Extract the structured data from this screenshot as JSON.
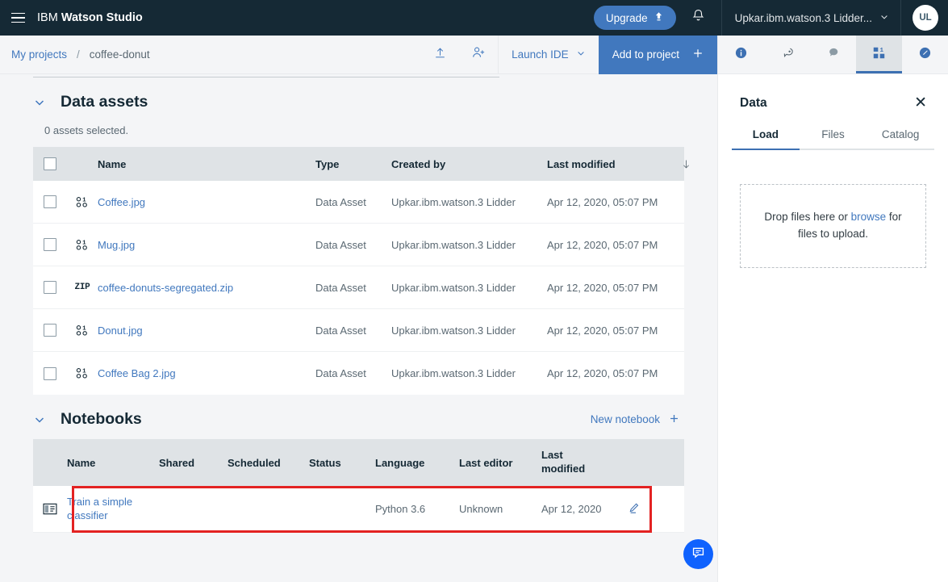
{
  "topbar": {
    "menu_icon": "hamburger-menu-icon",
    "brand_prefix": "IBM",
    "brand_name": "Watson Studio",
    "upgrade_label": "Upgrade",
    "upgrade_icon": "upgrade-arrow-icon",
    "bell_icon": "notification-bell-icon",
    "account_name": "Upkar.ibm.watson.3 Lidder...",
    "account_chevron": "chevron-down-icon",
    "avatar_initials": "UL",
    "accent_color": "#4178be",
    "bar_color": "#152935"
  },
  "actionbar": {
    "breadcrumb_root": "My projects",
    "breadcrumb_separator": "/",
    "breadcrumb_current": "coffee-donut",
    "upload_icon": "upload-icon",
    "add_collaborator_icon": "add-user-icon",
    "launch_ide_label": "Launch IDE",
    "launch_ide_chevron": "chevron-down-icon",
    "add_to_project_label": "Add to project",
    "add_to_project_icon": "plus-icon"
  },
  "data_assets": {
    "title": "Data assets",
    "collapse_icon": "chevron-down-icon",
    "selected_text": "0 assets selected.",
    "columns": [
      "Name",
      "Type",
      "Created by",
      "Last modified"
    ],
    "sort_icon": "sort-descending-arrow-icon",
    "rows": [
      {
        "icon": "binary-data-asset-icon",
        "name": "Coffee.jpg",
        "type": "Data Asset",
        "created_by": "Upkar.ibm.watson.3 Lidder",
        "last_modified": "Apr 12, 2020, 05:07 PM"
      },
      {
        "icon": "binary-data-asset-icon",
        "name": "Mug.jpg",
        "type": "Data Asset",
        "created_by": "Upkar.ibm.watson.3 Lidder",
        "last_modified": "Apr 12, 2020, 05:07 PM"
      },
      {
        "icon": "zip-file-icon",
        "name": "coffee-donuts-segregated.zip",
        "type": "Data Asset",
        "created_by": "Upkar.ibm.watson.3 Lidder",
        "last_modified": "Apr 12, 2020, 05:07 PM"
      },
      {
        "icon": "binary-data-asset-icon",
        "name": "Donut.jpg",
        "type": "Data Asset",
        "created_by": "Upkar.ibm.watson.3 Lidder",
        "last_modified": "Apr 12, 2020, 05:07 PM"
      },
      {
        "icon": "binary-data-asset-icon",
        "name": "Coffee Bag 2.jpg",
        "type": "Data Asset",
        "created_by": "Upkar.ibm.watson.3 Lidder",
        "last_modified": "Apr 12, 2020, 05:07 PM"
      }
    ]
  },
  "notebooks": {
    "title": "Notebooks",
    "collapse_icon": "chevron-down-icon",
    "new_notebook_label": "New notebook",
    "new_notebook_icon": "plus-icon",
    "columns": {
      "name": "Name",
      "shared": "Shared",
      "scheduled": "Scheduled",
      "status": "Status",
      "language": "Language",
      "last_editor": "Last editor",
      "last_modified_line1": "Last",
      "last_modified_line2": "modified"
    },
    "rows": [
      {
        "icon": "notebook-icon",
        "name": "Train a simple classifier",
        "shared": "",
        "scheduled": "",
        "status": "",
        "language": "Python 3.6",
        "last_editor": "Unknown",
        "last_modified": "Apr 12, 2020",
        "edit_icon": "pencil-edit-icon",
        "highlighted": true
      }
    ],
    "highlight_color": "#e32222"
  },
  "panel": {
    "tabs": [
      {
        "icon": "info-circle-icon",
        "active": false
      },
      {
        "icon": "comment-add-icon",
        "active": false
      },
      {
        "icon": "comment-icon",
        "active": false
      },
      {
        "icon": "grid-assets-icon",
        "active": true
      },
      {
        "icon": "pencil-circle-icon",
        "active": false
      }
    ],
    "title": "Data",
    "close_icon": "close-icon",
    "subtabs": [
      {
        "label": "Load",
        "active": true
      },
      {
        "label": "Files",
        "active": false
      },
      {
        "label": "Catalog",
        "active": false
      }
    ],
    "dropzone": {
      "text_before": "Drop files here or ",
      "browse_label": "browse",
      "text_after": " for files to upload."
    }
  },
  "chat": {
    "icon": "chat-bubble-icon",
    "color": "#0f62fe"
  }
}
